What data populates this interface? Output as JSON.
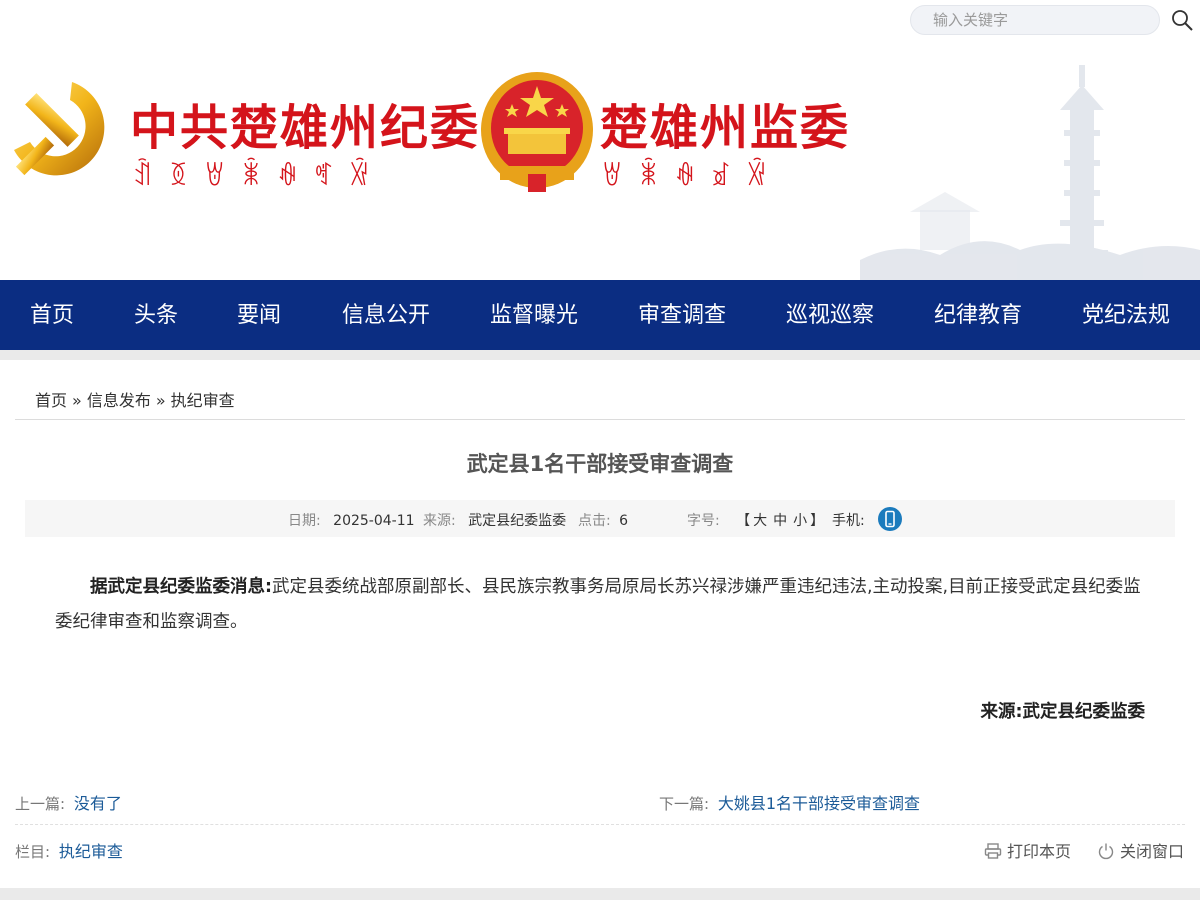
{
  "search": {
    "placeholder": "输入关键字",
    "icon": "search-icon"
  },
  "header": {
    "banner_left": "中共楚雄州纪委",
    "banner_right": "楚雄州监委",
    "yi_left": "ꀉꅉꇐꉚꊿꈩꑞ",
    "yi_right": "ꇐꉚꊿꀃꑞ",
    "emblem_left": "party-emblem-icon",
    "emblem_right": "national-emblem-icon",
    "brand_color": "#d4141b"
  },
  "nav": {
    "bg_color": "#0b2d82",
    "items": [
      "首页",
      "头条",
      "要闻",
      "信息公开",
      "监督曝光",
      "审查调查",
      "巡视巡察",
      "纪律教育",
      "党纪法规"
    ]
  },
  "breadcrumb": {
    "items": [
      "首页",
      "信息发布",
      "执纪审查"
    ],
    "separator": "»"
  },
  "article": {
    "title": "武定县1名干部接受审查调查",
    "meta": {
      "date_label": "日期:",
      "date": "2025-04-11",
      "source_label": "来源:",
      "source": "武定县纪委监委",
      "clicks_label": "点击:",
      "clicks": "6",
      "fontsize_label": "字号:",
      "fontsize_open": "【",
      "fontsize_large": "大",
      "fontsize_medium": "中",
      "fontsize_small": "小",
      "fontsize_close": "】",
      "phone_label": "手机:"
    },
    "lead": "据武定县纪委监委消息:",
    "body": "武定县委统战部原副部长、县民族宗教事务局原局长苏兴禄涉嫌严重违纪违法,主动投案,目前正接受武定县纪委监委纪律审查和监察调查。",
    "source_line": "来源:武定县纪委监委"
  },
  "prev_next": {
    "prev_label": "上一篇:",
    "prev": "没有了",
    "next_label": "下一篇:",
    "next": "大姚县1名干部接受审查调查"
  },
  "column": {
    "label": "栏目:",
    "value": "执纪审查"
  },
  "tools": {
    "print": "打印本页",
    "close": "关闭窗口"
  },
  "link_color": "#1c5b98"
}
